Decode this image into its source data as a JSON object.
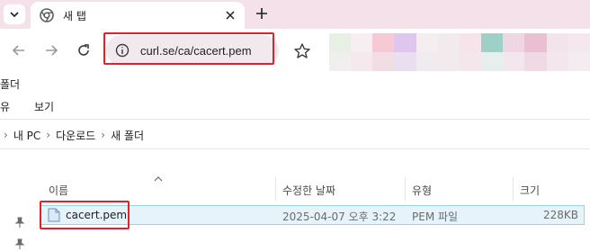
{
  "browser": {
    "tab": {
      "title": "새 탭"
    },
    "address_bar": {
      "url": "curl.se/ca/cacert.pem"
    }
  },
  "explorer": {
    "window_title": "폴더",
    "menu": [
      {
        "label": "유"
      },
      {
        "label": "보기"
      }
    ],
    "breadcrumb": [
      "내 PC",
      "다운로드",
      "새 폴더"
    ],
    "columns": [
      "이름",
      "수정한 날짜",
      "유형",
      "크기"
    ],
    "files": [
      {
        "name": "cacert.pem",
        "modified": "2025-04-07 오후 3:22",
        "type": "PEM 파일",
        "size": "228KB"
      }
    ]
  },
  "colors": {
    "accent_highlight": "#e0202a",
    "tabstrip": "#f4e1ea",
    "selection": "#e5f3fb"
  },
  "icons": [
    "tab-list-icon",
    "chrome-favicon-icon",
    "close-icon",
    "new-tab-icon",
    "back-icon",
    "forward-icon",
    "reload-icon",
    "site-info-icon",
    "bookmark-star-icon",
    "sort-up-icon",
    "file-icon",
    "pin-icon"
  ]
}
